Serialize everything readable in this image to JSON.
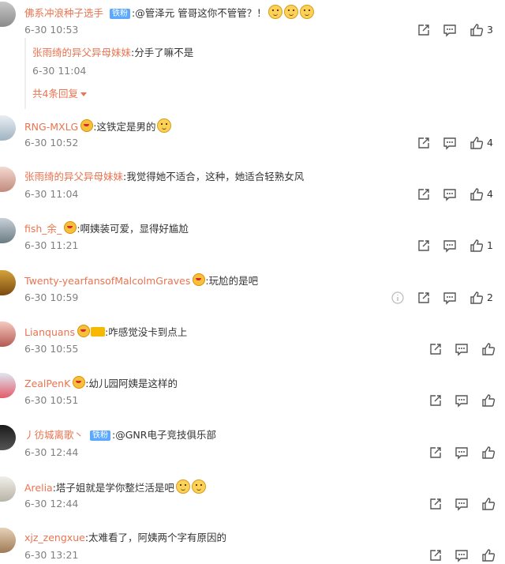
{
  "top_comment": {
    "author": "佛系冲浪种子选手",
    "badge": "铁粉",
    "text": ":@管泽元 管哥这你不管管？！",
    "time": "6-30 10:53",
    "likes": "3",
    "reply": {
      "author": "张雨绮的异父异母妹妹",
      "text": ":分手了嘛不是",
      "time": "6-30 11:04"
    },
    "more_replies": "共4条回复"
  },
  "comments": [
    {
      "author": "RNG-MXLG",
      "text": ":这铁定是男的",
      "time": "6-30 10:52",
      "likes": "4"
    },
    {
      "author": "张雨绮的异父异母妹妹",
      "text": ":我觉得她不适合，这种，她适合轻熟女风",
      "time": "6-30 11:04",
      "likes": "4"
    },
    {
      "author": "fish_余_",
      "text": ":啊姨装可爱，显得好尴尬",
      "time": "6-30 11:21",
      "likes": "1"
    },
    {
      "author": "Twenty-yearfansofMalcolmGraves",
      "text": ":玩尬的是吧",
      "time": "6-30 10:59",
      "likes": "2"
    },
    {
      "author": "Lianquans",
      "text": ":咋感觉没卡到点上",
      "time": "6-30 10:55",
      "likes": ""
    },
    {
      "author": "ZealPenK",
      "text": ":幼儿园阿姨是这样的",
      "time": "6-30 10:51",
      "likes": ""
    },
    {
      "author": "丿彷城离歌丶",
      "badge": "铁粉",
      "text": ":@GNR电子竞技俱乐部",
      "time": "6-30 12:44",
      "likes": ""
    },
    {
      "author": "Arelia",
      "text": ":塔子姐就是学你整烂活是吧",
      "time": "6-30 12:44",
      "likes": ""
    },
    {
      "author": "xjz_zengxue",
      "text": ":太难看了，阿姨两个字有原因的",
      "time": "6-30 13:21",
      "likes": ""
    }
  ],
  "colors": {
    "name": "#eb7350",
    "badge": "#5aa8ff",
    "time": "#808080"
  }
}
